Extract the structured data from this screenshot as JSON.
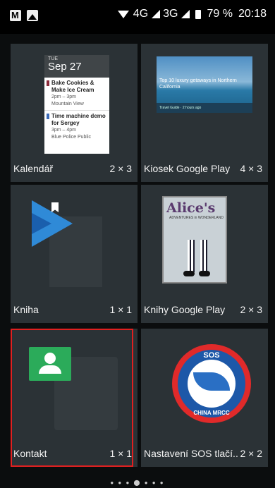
{
  "statusbar": {
    "net1": "4G",
    "net2": "3G",
    "battery": "79 %",
    "time": "20:18"
  },
  "widgets": [
    {
      "name": "Kalendář",
      "size": "2 × 3"
    },
    {
      "name": "Kiosek Google Play",
      "size": "4 × 3"
    },
    {
      "name": "Kniha",
      "size": "1 × 1"
    },
    {
      "name": "Knihy Google Play",
      "size": "2 × 3"
    },
    {
      "name": "Kontakt",
      "size": "1 × 1"
    },
    {
      "name": "Nastavení SOS tlačí..",
      "size": "2 × 2"
    }
  ],
  "calendar_preview": {
    "weekday": "TUE",
    "date": "Sep 27",
    "events": [
      {
        "title": "Bake Cookies & Make Ice Cream",
        "time": "2pm – 3pm",
        "place": "Mountain View",
        "color": "#8b2b3b"
      },
      {
        "title": "Time machine demo for Sergey",
        "time": "3pm – 4pm",
        "place": "Blue Police Public",
        "color": "#3c6bb8"
      }
    ]
  },
  "kiosk_preview": {
    "headline": "Top 10 luxury getaways in Northern California",
    "source": "Travel Guide · 2 hours ago"
  },
  "alice_preview": {
    "title": "Alice's",
    "subtitle": "ADVENTURES in WONDERLAND"
  },
  "sos_preview": {
    "top": "SOS",
    "bottom": "CHINA MRCC"
  }
}
